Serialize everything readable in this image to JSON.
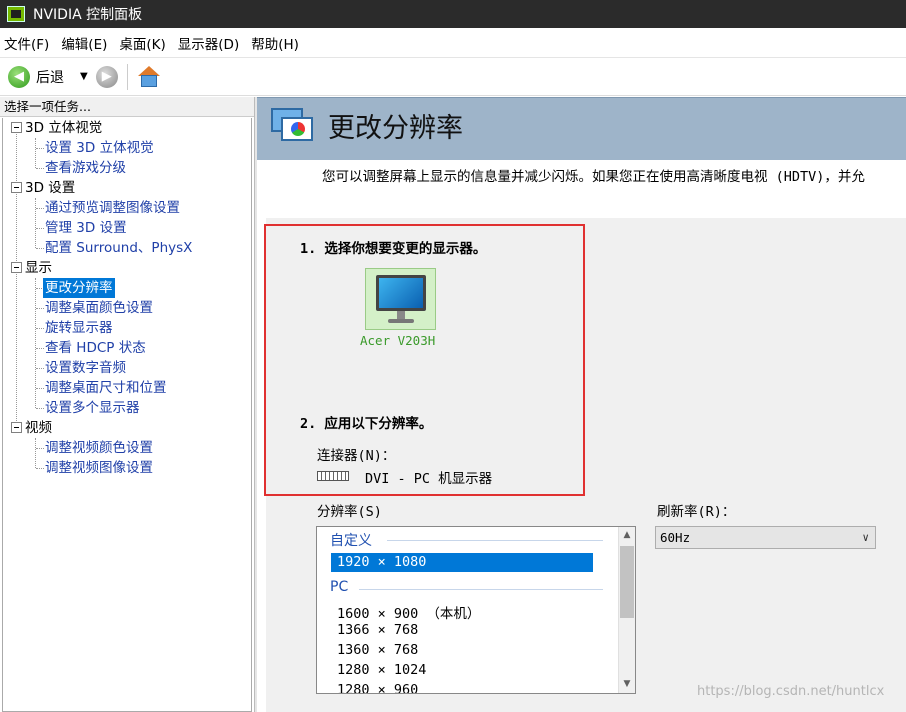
{
  "window": {
    "title": "NVIDIA 控制面板"
  },
  "menu": [
    {
      "label": "文件(F)"
    },
    {
      "label": "编辑(E)"
    },
    {
      "label": "桌面(K)"
    },
    {
      "label": "显示器(D)"
    },
    {
      "label": "帮助(H)"
    }
  ],
  "toolbar": {
    "back_label": "后退",
    "back_icon": "back-arrow-icon",
    "forward_icon": "forward-arrow-icon",
    "home_icon": "home-icon"
  },
  "sidebar": {
    "header": "选择一项任务...",
    "categories": [
      {
        "label": "3D 立体视觉",
        "items": [
          "设置 3D 立体视觉",
          "查看游戏分级"
        ]
      },
      {
        "label": "3D 设置",
        "items": [
          "通过预览调整图像设置",
          "管理 3D 设置",
          "配置 Surround、PhysX"
        ]
      },
      {
        "label": "显示",
        "items": [
          "更改分辨率",
          "调整桌面颜色设置",
          "旋转显示器",
          "查看 HDCP 状态",
          "设置数字音频",
          "调整桌面尺寸和位置",
          "设置多个显示器"
        ]
      },
      {
        "label": "视频",
        "items": [
          "调整视频颜色设置",
          "调整视频图像设置"
        ]
      }
    ],
    "selected": "更改分辨率"
  },
  "page": {
    "title": "更改分辨率",
    "description": "您可以调整屏幕上显示的信息量并减少闪烁。如果您正在使用高清晰度电视 (HDTV)，并允"
  },
  "step1": {
    "title": "1. 选择你想要变更的显示器。",
    "monitor_name": "Acer V203H"
  },
  "step2": {
    "title": "2. 应用以下分辨率。",
    "connector_label": "连接器(N)：",
    "connector_value": "DVI - PC 机显示器"
  },
  "resolution": {
    "label": "分辨率(S)",
    "groups": [
      {
        "name": "自定义",
        "items": [
          "1920 × 1080"
        ]
      },
      {
        "name": "PC",
        "items": [
          "1600 × 900 （本机）",
          "1366 × 768",
          "1360 × 768",
          "1280 × 1024",
          "1280 × 960"
        ]
      }
    ],
    "selected": "1920 × 1080"
  },
  "refresh": {
    "label": "刷新率(R)：",
    "value": "60Hz"
  },
  "colors": {
    "titlebar": "#2b2b2b",
    "banner": "#9eb4c9",
    "selection": "#0078d7",
    "link": "#2040a8",
    "highlight_border": "#e03030",
    "monitor_label": "#3a9a2a"
  },
  "watermark": "https://blog.csdn.net/huntlcx"
}
